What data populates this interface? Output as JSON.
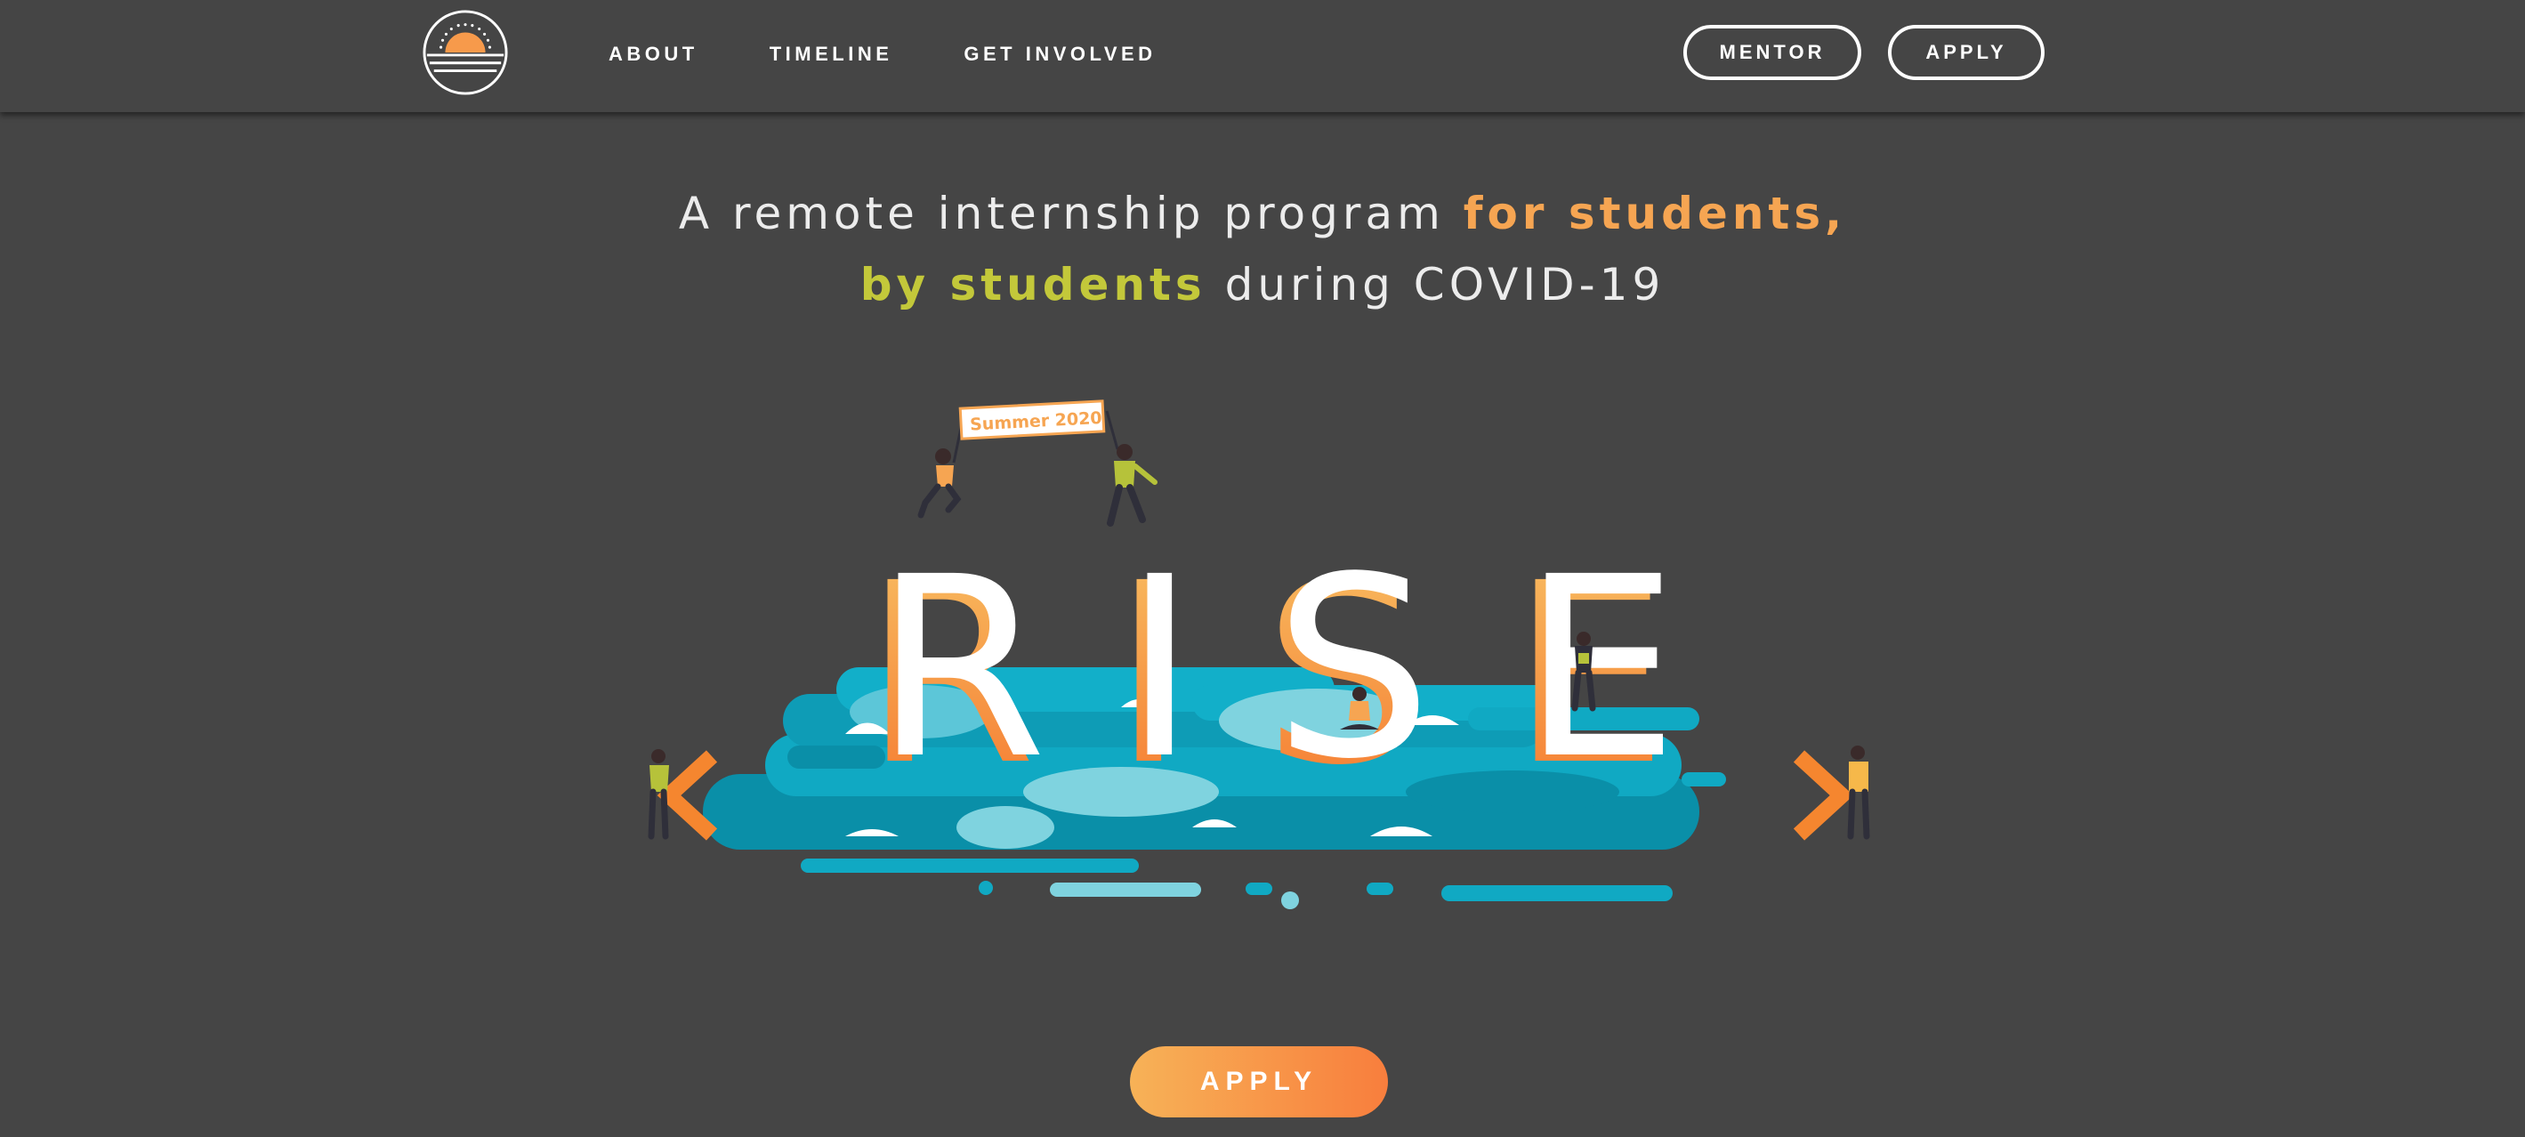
{
  "header": {
    "logo_icon": "sunrise-logo-icon",
    "nav": [
      {
        "label": "ABOUT"
      },
      {
        "label": "TIMELINE"
      },
      {
        "label": "GET INVOLVED"
      }
    ],
    "mentor_label": "MENTOR",
    "apply_label": "APPLY"
  },
  "hero": {
    "headline_part1": "A remote internship program ",
    "headline_highlight1": "for students,",
    "headline_highlight2": "by students",
    "headline_part2": " during COVID-19",
    "banner_text": "Summer 2020",
    "title_letters": [
      "R",
      "I",
      "S",
      "E"
    ],
    "prev_icon": "chevron-left-icon",
    "next_icon": "chevron-right-icon"
  },
  "cta": {
    "apply_label": "APPLY"
  },
  "colors": {
    "background": "#454545",
    "orange": "#f6a552",
    "green": "#c3c83a",
    "water": "#10a9c3",
    "button_gradient_start": "#f7b257",
    "button_gradient_end": "#f87e3d"
  }
}
